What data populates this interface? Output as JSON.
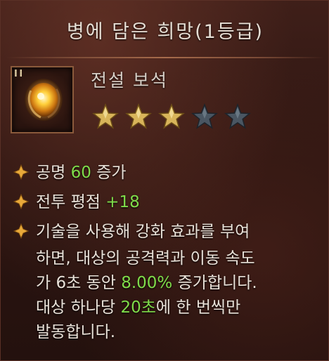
{
  "item": {
    "title": "병에 담은 희망(1등급)",
    "subtitle": "전설 보석",
    "icon": "orb-gem-icon",
    "tier_mark": "I I",
    "rating": {
      "filled": 3,
      "total": 5
    }
  },
  "stats": [
    {
      "label": "공명 ",
      "value": "60",
      "suffix": " 증가"
    },
    {
      "label": "전투 평점 ",
      "value": "+18",
      "suffix": ""
    }
  ],
  "description": {
    "line1": "기술을 사용해 강화 효과를 부여",
    "line2": "하면, 대상의 공격력과 이동 속도",
    "line3_a": "가 6초 동안 ",
    "line3_value": "8.00%",
    "line3_b": " 증가합니다.",
    "line4_a": " 대상 하나당 ",
    "line4_value": "20초",
    "line4_b": "에 한 번씩만",
    "line5": "발동합니다."
  },
  "colors": {
    "value": "#7fdc4a",
    "text": "#e9e1d8",
    "bullet": "#e8a93a",
    "star_filled": "#d8b45a",
    "star_empty": "#4a5662"
  }
}
